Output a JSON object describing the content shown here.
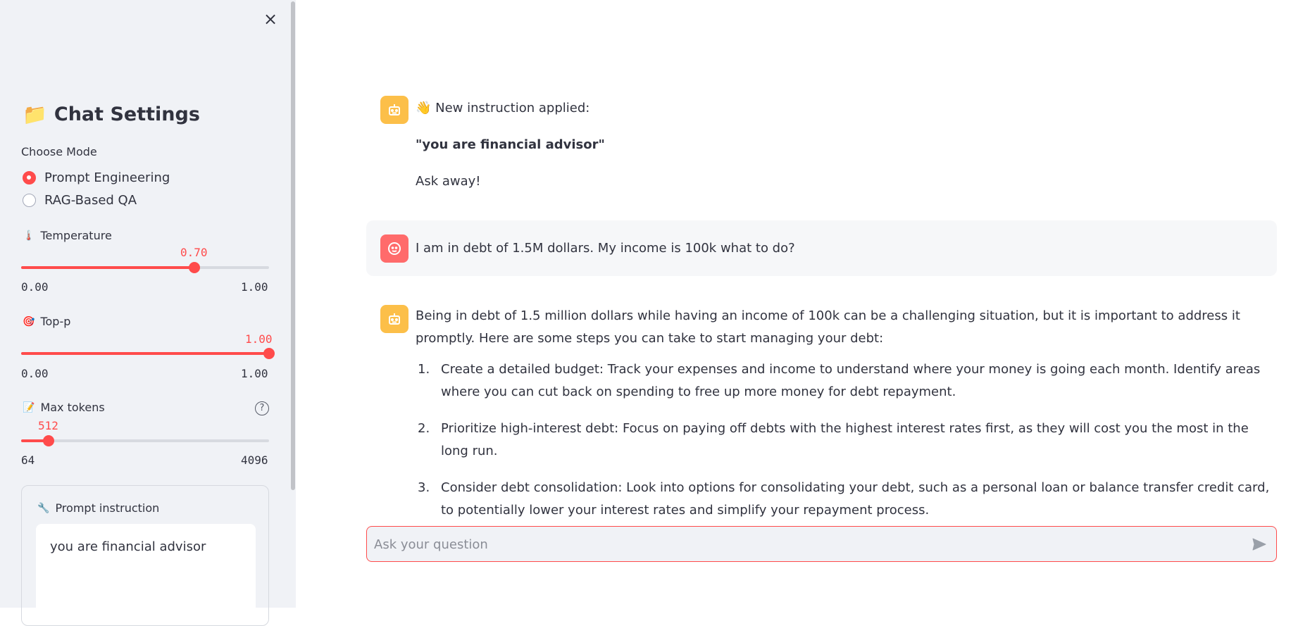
{
  "sidebar": {
    "title_emoji": "📁",
    "title": "Chat Settings",
    "mode_label": "Choose Mode",
    "modes": [
      {
        "label": "Prompt Engineering",
        "selected": true
      },
      {
        "label": "RAG-Based QA",
        "selected": false
      }
    ],
    "temperature": {
      "emoji": "🌡️",
      "label": "Temperature",
      "value": "0.70",
      "min": "0.00",
      "max": "1.00",
      "fraction": 0.7
    },
    "top_p": {
      "emoji": "🎯",
      "label": "Top-p",
      "value": "1.00",
      "min": "0.00",
      "max": "1.00",
      "fraction": 1.0
    },
    "max_tokens": {
      "emoji": "📝",
      "label": "Max tokens",
      "value": "512",
      "min": "64",
      "max": "4096",
      "fraction": 0.111,
      "help_icon": "?"
    },
    "prompt": {
      "emoji": "🔧",
      "label": "Prompt instruction",
      "value": "you are financial advisor"
    },
    "close_icon": "×"
  },
  "chat": {
    "messages": [
      {
        "role": "assistant",
        "line1": "👋 New instruction applied:",
        "line2": "\"you are financial advisor\"",
        "line3": "Ask away!"
      },
      {
        "role": "user",
        "text": "I am in debt of 1.5M dollars. My income is 100k what to do?"
      },
      {
        "role": "assistant",
        "intro": "Being in debt of 1.5 million dollars while having an income of 100k can be a challenging situation, but it is important to address it promptly. Here are some steps you can take to start managing your debt:",
        "steps": [
          {
            "num": "1.",
            "text": "Create a detailed budget: Track your expenses and income to understand where your money is going each month. Identify areas where you can cut back on spending to free up more money for debt repayment."
          },
          {
            "num": "2.",
            "text": "Prioritize high-interest debt: Focus on paying off debts with the highest interest rates first, as they will cost you the most in the long run."
          },
          {
            "num": "3.",
            "text": "Consider debt consolidation: Look into options for consolidating your debt, such as a personal loan or balance transfer credit card, to potentially lower your interest rates and simplify your repayment process."
          }
        ]
      }
    ],
    "input_placeholder": "Ask your question",
    "accent": "#ff4b4b",
    "bot_avatar_color": "#fcbf49",
    "user_avatar_color": "#ff6b6b"
  }
}
